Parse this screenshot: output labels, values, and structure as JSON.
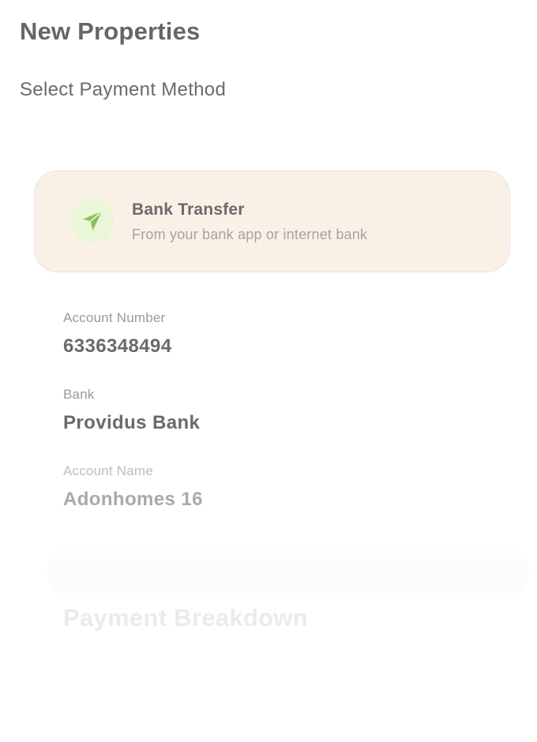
{
  "header": {
    "title": "New Properties"
  },
  "payment": {
    "section_title": "Select Payment Method",
    "method": {
      "name": "Bank Transfer",
      "description": "From your bank app or internet bank",
      "icon": "send-icon",
      "icon_color": "#8fc05a",
      "icon_bg": "#eaf6d8",
      "card_bg": "#f9f1e6"
    }
  },
  "account": {
    "number_label": "Account Number",
    "number": "6336348494",
    "bank_label": "Bank",
    "bank": "Providus Bank",
    "name_label": "Account Name",
    "name": "Adonhomes 16"
  },
  "breakdown": {
    "title": "Payment Breakdown"
  }
}
